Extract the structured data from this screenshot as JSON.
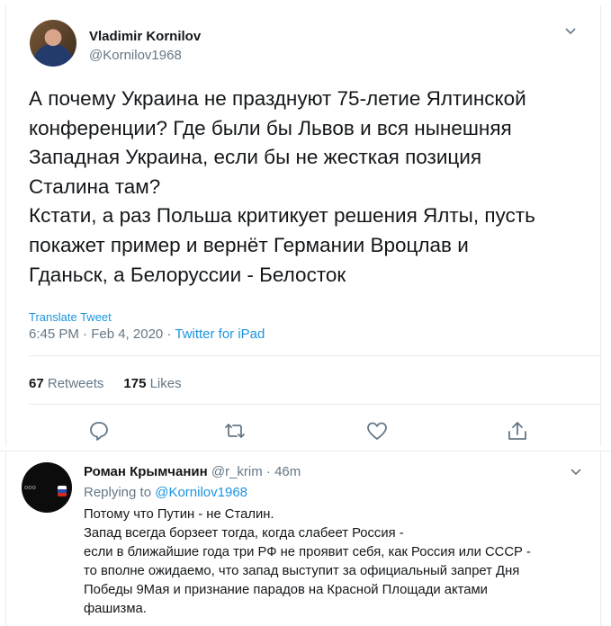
{
  "tweet": {
    "author_name": "Vladimir Kornilov",
    "author_handle": "@Kornilov1968",
    "text_lines": [
      "А почему Украина не празднуют 75-летие Ялтинской",
      "конференции? Где были бы Львов и вся нынешняя",
      "Западная Украина, если бы не жесткая позиция",
      "Сталина там?",
      "Кстати, а раз Польша критикует решения Ялты, пусть",
      "покажет пример и вернёт Германии Вроцлав и",
      "Гданьск, а Белоруссии - Белосток"
    ],
    "translate_label": "Translate Tweet",
    "timestamp": "6:45 PM · Feb 4, 2020 · ",
    "source": "Twitter for iPad",
    "retweets_count": "67",
    "retweets_label": "Retweets",
    "likes_count": "175",
    "likes_label": "Likes"
  },
  "actions": {
    "reply_icon": "speech-bubble-icon",
    "retweet_icon": "retweet-icon",
    "like_icon": "heart-icon",
    "share_icon": "share-icon",
    "icon_color": "#657786"
  },
  "reply": {
    "author_name": "Роман Крымчанин",
    "author_handle": "@r_krim",
    "time": "· 46m",
    "replying_to_label": "Replying to ",
    "replying_to_handle": "@Kornilov1968",
    "text_lines": [
      "Потому что Путин - не Сталин.",
      "Запад всегда борзеет тогда, когда слабеет Россия -",
      "если в ближайшие года три РФ не проявит себя, как Россия или СССР -",
      "то вполне ожидаемо, что запад выступит за официальный запрет Дня",
      "Победы 9Мая и признание парадов на Красной Площади актами",
      "фашизма."
    ]
  },
  "colors": {
    "link": "#1b95e0",
    "secondary_text": "#657786",
    "primary_text": "#14171a",
    "divider": "#e6ecf0"
  }
}
